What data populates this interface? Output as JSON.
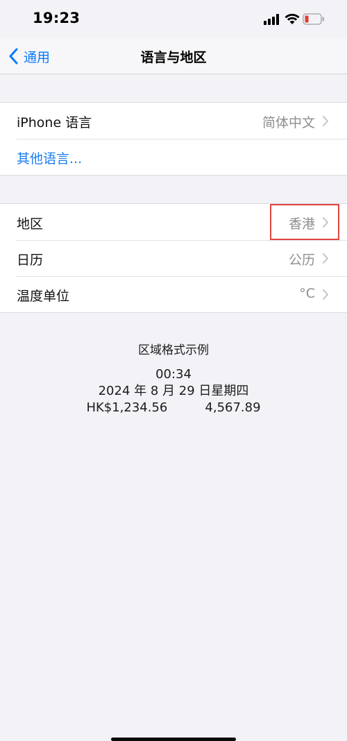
{
  "status_bar": {
    "time": "19:23",
    "icons": [
      "cellular-signal-icon",
      "wifi-icon",
      "battery-low-icon"
    ],
    "battery_color": "#e53935"
  },
  "nav": {
    "back_label": "通用",
    "title": "语言与地区",
    "accent": "#0a7aff"
  },
  "language_group": {
    "iphone_language_label": "iPhone 语言",
    "iphone_language_value": "简体中文",
    "other_languages_label": "其他语言..."
  },
  "region_group": {
    "region_label": "地区",
    "region_value": "香港",
    "calendar_label": "日历",
    "calendar_value": "公历",
    "temperature_label": "温度单位",
    "temperature_value": "°C",
    "highlight_color": "#e0453f"
  },
  "format_example": {
    "title": "区域格式示例",
    "time": "00:34",
    "date": "2024 年 8 月 29 日星期四",
    "currency": "HK$1,234.56",
    "number": "4,567.89"
  }
}
